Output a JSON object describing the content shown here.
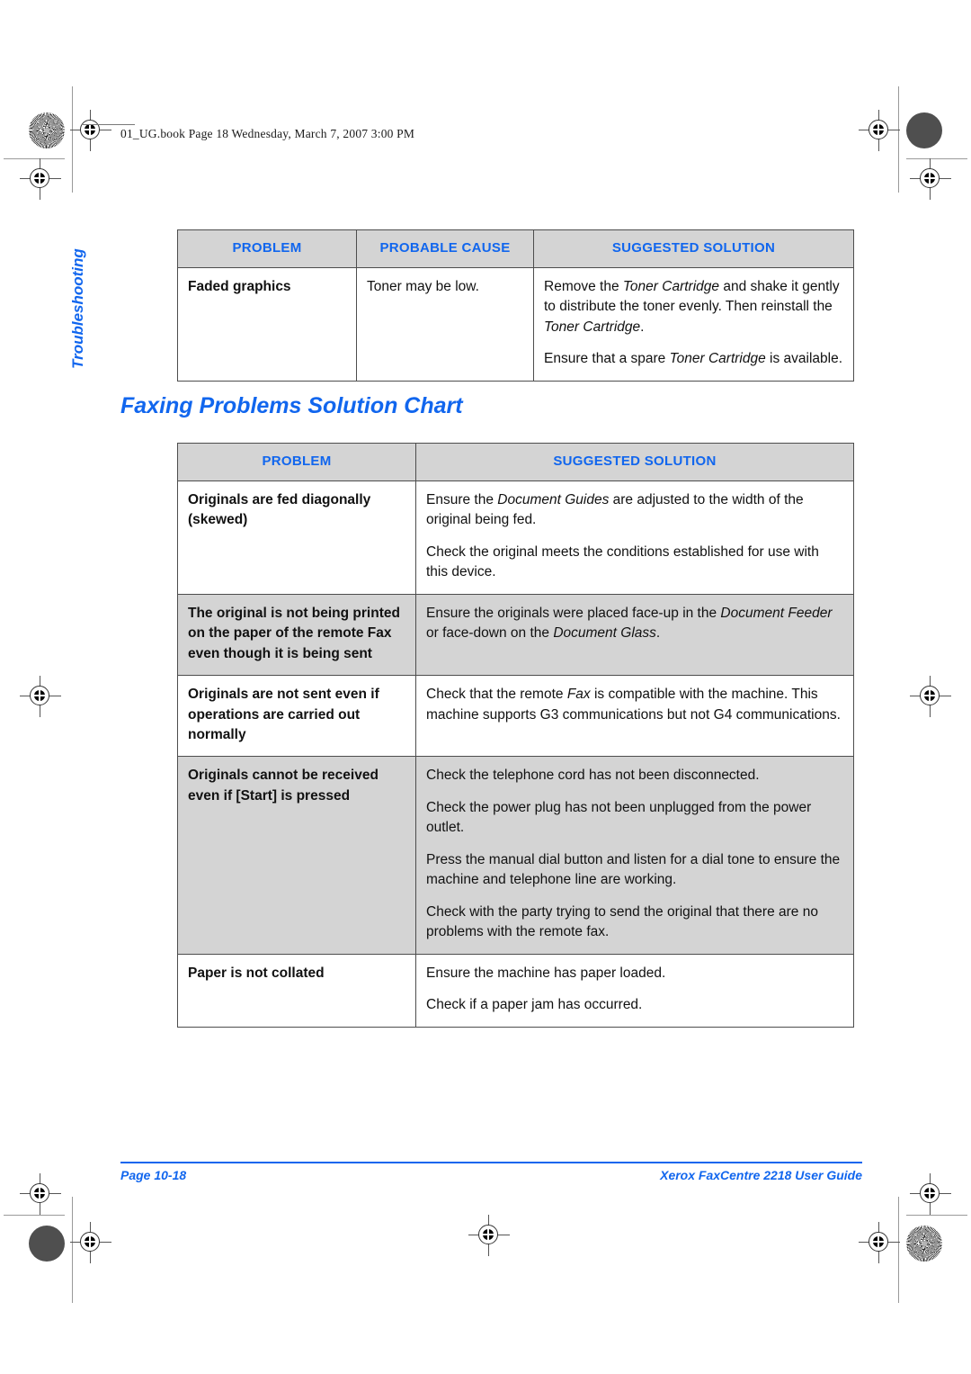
{
  "page": {
    "file_header": "01_UG.book  Page 18  Wednesday, March 7, 2007  3:00 PM",
    "chapter_tab": "Troubleshooting",
    "section_heading": "Faxing Problems Solution Chart",
    "footer_left": "Page 10-18",
    "footer_right": "Xerox FaxCentre 2218 User Guide",
    "accent_color": "#1166ee",
    "header_fill": "#d4d4d4"
  },
  "copy_table": {
    "headers": {
      "problem": "PROBLEM",
      "probable_cause": "PROBABLE CAUSE",
      "suggested_solution": "SUGGESTED SOLUTION"
    },
    "rows": [
      {
        "problem": "Faded graphics",
        "probable_cause": "Toner may be low.",
        "solution": [
          "Remove the <em>Toner Cartridge</em> and shake it gently to distribute the toner evenly. Then reinstall the <em>Toner Cartridge</em>.",
          "Ensure that a spare <em>Toner Cartridge</em> is available."
        ],
        "shaded": false
      }
    ]
  },
  "fax_table": {
    "headers": {
      "problem": "PROBLEM",
      "suggested_solution": "SUGGESTED SOLUTION"
    },
    "rows": [
      {
        "problem": "Originals are fed diagonally (skewed)",
        "solution": [
          "Ensure the <em>Document Guides</em> are adjusted to the width of the original being fed.",
          "Check the original meets the conditions established for use with this device."
        ],
        "shaded": false
      },
      {
        "problem": "The original is not being printed on the paper of the remote Fax even though it is being sent",
        "solution": [
          "Ensure the originals were placed face-up in the <em>Document Feeder</em> or face-down on the <em>Document Glass</em>."
        ],
        "shaded": true
      },
      {
        "problem": "Originals are not sent even if operations are carried out normally",
        "solution": [
          "Check that the remote <em>Fax</em> is compatible with the machine. This machine supports G3 communications but not G4 communications."
        ],
        "shaded": false
      },
      {
        "problem": "Originals cannot be received even if [Start] is pressed",
        "solution": [
          "Check the telephone cord has not been disconnected.",
          "Check the power plug has not been unplugged from the power outlet.",
          "Press the manual dial button and listen for a dial tone to ensure the machine and telephone line are working.",
          "Check with the party trying to send the original that there are no problems with the remote fax."
        ],
        "shaded": true
      },
      {
        "problem": "Paper is not collated",
        "solution": [
          "Ensure the machine has paper loaded.",
          "Check if a paper jam has occurred."
        ],
        "shaded": false
      }
    ]
  }
}
